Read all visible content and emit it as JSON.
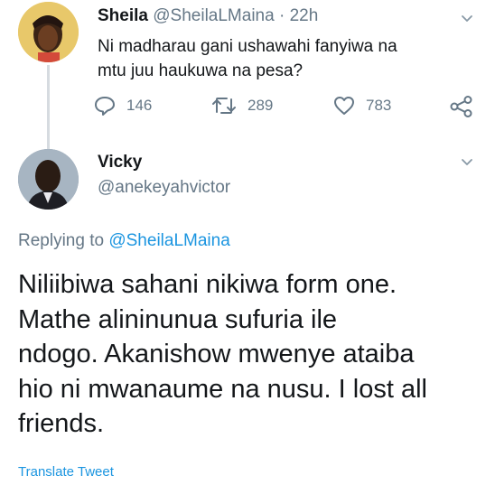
{
  "tweet": {
    "author_name": "Sheila",
    "author_handle": "@SheilaLMaina",
    "separator": " · ",
    "time": "22h",
    "text_line1": "Ni madharau gani ushawahi fanyiwa na",
    "text_line2": "mtu juu haukuwa na pesa?",
    "replies": "146",
    "retweets": "289",
    "likes": "783"
  },
  "reply": {
    "author_name": "Vicky",
    "author_handle": "@anekeyahvictor",
    "replying_prefix": "Replying to ",
    "replying_to": "@SheilaLMaina",
    "text_line1": "Niliibiwa sahani nikiwa form one.",
    "text_line2": "Mathe alininunua sufuria ile",
    "text_line3": "ndogo. Akanishow mwenye ataiba",
    "text_line4": "hio ni mwanaume na nusu. I lost all",
    "text_line5": "friends.",
    "translate_label": "Translate Tweet"
  },
  "icons": {
    "reply": "reply-icon",
    "retweet": "retweet-icon",
    "like": "heart-icon",
    "share": "share-icon",
    "menu": "chevron-down-icon"
  },
  "colors": {
    "link": "#1b95e0",
    "secondary_text": "#657786",
    "primary_text": "#14171a",
    "thread_line": "#d6dbe0"
  }
}
